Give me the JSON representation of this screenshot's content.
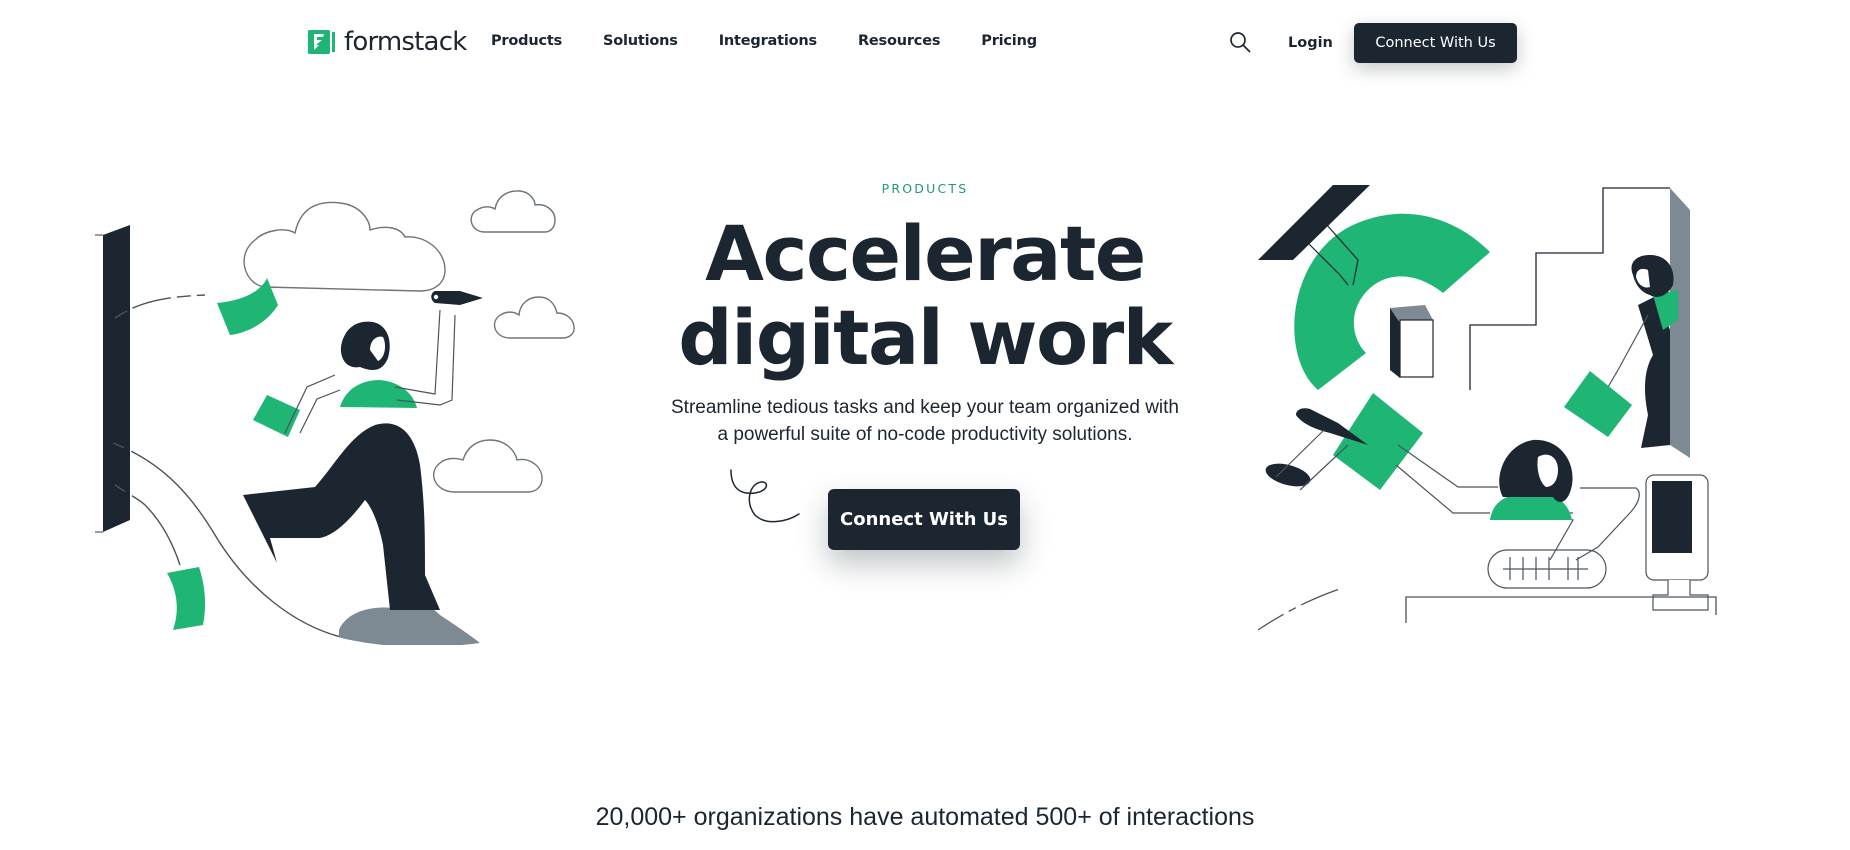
{
  "header": {
    "logo": {
      "text": "formstack",
      "icon": "formstack-logo-icon"
    },
    "nav": [
      {
        "label": "Products"
      },
      {
        "label": "Solutions"
      },
      {
        "label": "Integrations"
      },
      {
        "label": "Resources"
      },
      {
        "label": "Pricing"
      }
    ],
    "search_icon": "search-icon",
    "login_label": "Login",
    "cta_label": "Connect With Us"
  },
  "hero": {
    "eyebrow": "PRODUCTS",
    "headline_line1": "Accelerate",
    "headline_line2": "digital work",
    "subtitle_line1": "Streamline tedious tasks and keep your team organized with",
    "subtitle_line2": "a powerful suite of no-code productivity solutions.",
    "cta_label": "Connect With Us",
    "left_illustration": "woman-running-with-papers-illustration",
    "right_illustration": "team-working-at-computer-illustration"
  },
  "stats": {
    "text": "20,000+ organizations have automated 500+ of interactions"
  },
  "colors": {
    "brand_green": "#1fb574",
    "eyebrow_green": "#1f9d6a",
    "dark": "#1b2631",
    "gray": "#7d8a93"
  }
}
